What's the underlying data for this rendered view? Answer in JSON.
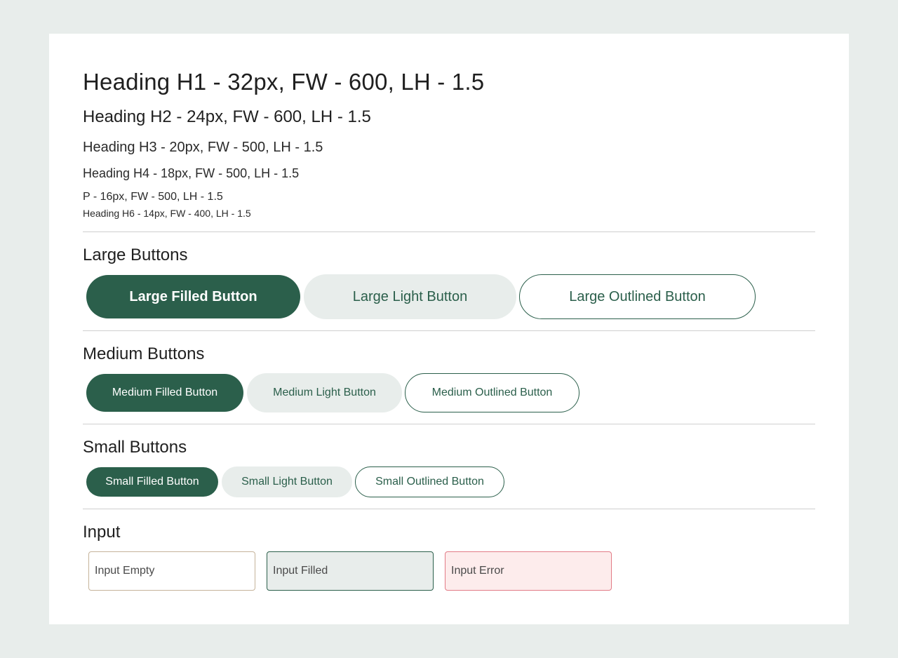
{
  "typography": {
    "h1": "Heading H1 - 32px, FW - 600, LH - 1.5",
    "h2": "Heading H2 - 24px, FW - 600, LH - 1.5",
    "h3": "Heading H3 - 20px, FW - 500, LH - 1.5",
    "h4": "Heading H4 - 18px, FW - 500, LH - 1.5",
    "p": "P - 16px, FW - 500, LH - 1.5",
    "h6": "Heading H6 - 14px, FW - 400, LH - 1.5"
  },
  "large_buttons": {
    "title": "Large Buttons",
    "filled": "Large Filled Button",
    "light": "Large Light Button",
    "outlined": "Large Outlined Button"
  },
  "medium_buttons": {
    "title": "Medium Buttons",
    "filled": "Medium Filled Button",
    "light": "Medium Light Button",
    "outlined": "Medium Outlined Button"
  },
  "small_buttons": {
    "title": "Small Buttons",
    "filled": "Small Filled Button",
    "light": "Small Light Button",
    "outlined": "Small Outlined Button"
  },
  "inputs": {
    "title": "Input",
    "empty_value": "Input Empty",
    "filled_value": "Input Filled",
    "error_value": "Input Error"
  },
  "colors": {
    "primary": "#2b5f4b",
    "light": "#e8edeb",
    "error_border": "#e27b86",
    "error_bg": "#fdecec",
    "empty_border": "#c5b39a",
    "page_bg": "#e8edeb"
  }
}
